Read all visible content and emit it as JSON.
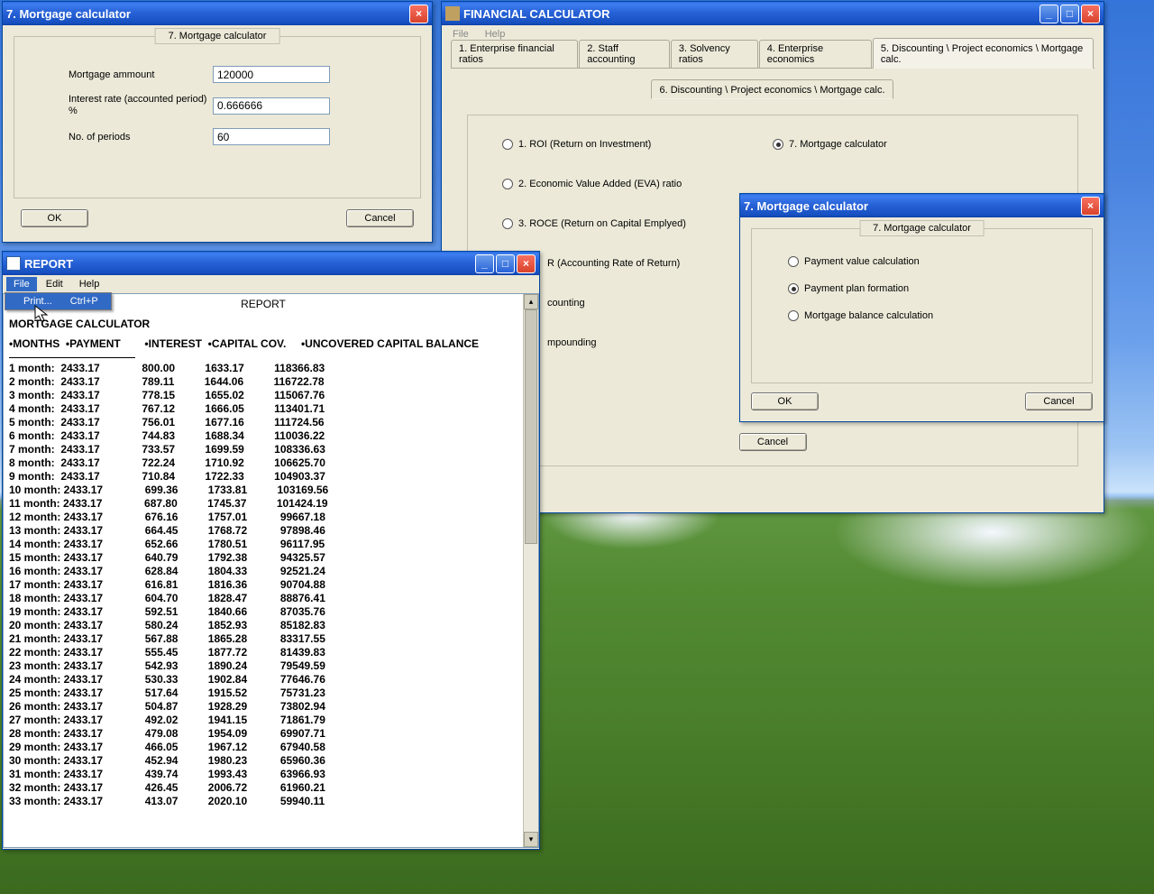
{
  "mortgage_dialog": {
    "title": "7. Mortgage calculator",
    "group_label": "7. Mortgage calculator",
    "fields": {
      "amount_label": "Mortgage ammount",
      "amount_value": "120000",
      "rate_label": "Interest rate (accounted period) %",
      "rate_value": "0.666666",
      "periods_label": "No. of periods",
      "periods_value": "60"
    },
    "ok": "OK",
    "cancel": "Cancel"
  },
  "financial_calc": {
    "title": "FINANCIAL CALCULATOR",
    "menu": {
      "file": "File",
      "help": "Help"
    },
    "tabs": [
      "1. Enterprise financial ratios",
      "2. Staff accounting",
      "3. Solvency ratios",
      "4. Enterprise economics",
      "5. Discounting \\ Project economics \\ Mortgage calc."
    ],
    "subtab": "6. Discounting \\ Project economics \\ Mortgage calc.",
    "options": {
      "opt1": "1. ROI (Return on Investment)",
      "opt7": "7. Mortgage calculator",
      "opt2": "2. Economic Value Added (EVA) ratio",
      "opt3": "3. ROCE (Return on Capital Emplyed)",
      "opt4_suffix": "R (Accounting Rate of Return)",
      "opt5_suffix": "counting",
      "opt6_suffix": "mpounding"
    },
    "cancel": "Cancel"
  },
  "mortgage_sub": {
    "title": "7. Mortgage calculator",
    "group": "7. Mortgage calculator",
    "opts": {
      "value_calc": "Payment value calculation",
      "plan": "Payment plan formation",
      "balance": "Mortgage balance calculation"
    },
    "ok": "OK",
    "cancel": "Cancel"
  },
  "report": {
    "title": "REPORT",
    "menu": {
      "file": "File",
      "edit": "Edit",
      "help": "Help"
    },
    "dropdown": {
      "print": "Print...",
      "shortcut": "Ctrl+P"
    },
    "body_title": "REPORT",
    "heading": "MORTGAGE CALCULATOR",
    "cols": "•MONTHS  •PAYMENT        •INTEREST  •CAPITAL COV.     •UNCOVERED CAPITAL BALANCE",
    "rows": [
      [
        "1 month:",
        "2433.17",
        "800.00",
        "1633.17",
        "118366.83"
      ],
      [
        "2 month:",
        "2433.17",
        "789.11",
        "1644.06",
        "116722.78"
      ],
      [
        "3 month:",
        "2433.17",
        "778.15",
        "1655.02",
        "115067.76"
      ],
      [
        "4 month:",
        "2433.17",
        "767.12",
        "1666.05",
        "113401.71"
      ],
      [
        "5 month:",
        "2433.17",
        "756.01",
        "1677.16",
        "111724.56"
      ],
      [
        "6 month:",
        "2433.17",
        "744.83",
        "1688.34",
        "110036.22"
      ],
      [
        "7 month:",
        "2433.17",
        "733.57",
        "1699.59",
        "108336.63"
      ],
      [
        "8 month:",
        "2433.17",
        "722.24",
        "1710.92",
        "106625.70"
      ],
      [
        "9 month:",
        "2433.17",
        "710.84",
        "1722.33",
        "104903.37"
      ],
      [
        "10 month:",
        "2433.17",
        "699.36",
        "1733.81",
        "103169.56"
      ],
      [
        "11 month:",
        "2433.17",
        "687.80",
        "1745.37",
        "101424.19"
      ],
      [
        "12 month:",
        "2433.17",
        "676.16",
        "1757.01",
        "99667.18"
      ],
      [
        "13 month:",
        "2433.17",
        "664.45",
        "1768.72",
        "97898.46"
      ],
      [
        "14 month:",
        "2433.17",
        "652.66",
        "1780.51",
        "96117.95"
      ],
      [
        "15 month:",
        "2433.17",
        "640.79",
        "1792.38",
        "94325.57"
      ],
      [
        "16 month:",
        "2433.17",
        "628.84",
        "1804.33",
        "92521.24"
      ],
      [
        "17 month:",
        "2433.17",
        "616.81",
        "1816.36",
        "90704.88"
      ],
      [
        "18 month:",
        "2433.17",
        "604.70",
        "1828.47",
        "88876.41"
      ],
      [
        "19 month:",
        "2433.17",
        "592.51",
        "1840.66",
        "87035.76"
      ],
      [
        "20 month:",
        "2433.17",
        "580.24",
        "1852.93",
        "85182.83"
      ],
      [
        "21 month:",
        "2433.17",
        "567.88",
        "1865.28",
        "83317.55"
      ],
      [
        "22 month:",
        "2433.17",
        "555.45",
        "1877.72",
        "81439.83"
      ],
      [
        "23 month:",
        "2433.17",
        "542.93",
        "1890.24",
        "79549.59"
      ],
      [
        "24 month:",
        "2433.17",
        "530.33",
        "1902.84",
        "77646.76"
      ],
      [
        "25 month:",
        "2433.17",
        "517.64",
        "1915.52",
        "75731.23"
      ],
      [
        "26 month:",
        "2433.17",
        "504.87",
        "1928.29",
        "73802.94"
      ],
      [
        "27 month:",
        "2433.17",
        "492.02",
        "1941.15",
        "71861.79"
      ],
      [
        "28 month:",
        "2433.17",
        "479.08",
        "1954.09",
        "69907.71"
      ],
      [
        "29 month:",
        "2433.17",
        "466.05",
        "1967.12",
        "67940.58"
      ],
      [
        "30 month:",
        "2433.17",
        "452.94",
        "1980.23",
        "65960.36"
      ],
      [
        "31 month:",
        "2433.17",
        "439.74",
        "1993.43",
        "63966.93"
      ],
      [
        "32 month:",
        "2433.17",
        "426.45",
        "2006.72",
        "61960.21"
      ],
      [
        "33 month:",
        "2433.17",
        "413.07",
        "2020.10",
        "59940.11"
      ]
    ]
  }
}
